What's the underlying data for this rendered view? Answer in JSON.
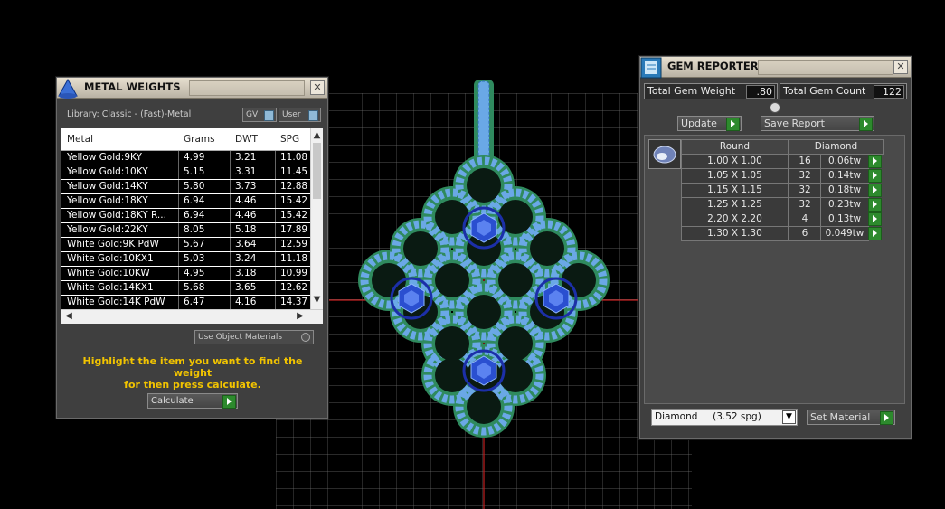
{
  "metal_weights": {
    "title": "METAL WEIGHTS",
    "library_label": "Library: Classic - (Fast)-Metal",
    "gv_toggle": "GV",
    "user_toggle": "User",
    "columns": [
      "Metal",
      "Grams",
      "DWT",
      "SPG"
    ],
    "rows": [
      [
        "Yellow Gold:9KY",
        "4.99",
        "3.21",
        "11.08"
      ],
      [
        "Yellow Gold:10KY",
        "5.15",
        "3.31",
        "11.45"
      ],
      [
        "Yellow Gold:14KY",
        "5.80",
        "3.73",
        "12.88"
      ],
      [
        "Yellow Gold:18KY",
        "6.94",
        "4.46",
        "15.42"
      ],
      [
        "Yellow Gold:18KY R...",
        "6.94",
        "4.46",
        "15.42"
      ],
      [
        "Yellow Gold:22KY",
        "8.05",
        "5.18",
        "17.89"
      ],
      [
        "White Gold:9K PdW",
        "5.67",
        "3.64",
        "12.59"
      ],
      [
        "White Gold:10KX1",
        "5.03",
        "3.24",
        "11.18"
      ],
      [
        "White Gold:10KW",
        "4.95",
        "3.18",
        "10.99"
      ],
      [
        "White Gold:14KX1",
        "5.68",
        "3.65",
        "12.62"
      ],
      [
        "White Gold:14K PdW",
        "6.47",
        "4.16",
        "14.37"
      ]
    ],
    "use_object_materials": "Use Object Materials",
    "instruction_line1": "Highlight the item you want to find the weight",
    "instruction_line2": "for then press calculate.",
    "calculate_label": "Calculate"
  },
  "gem_reporter": {
    "title": "GEM REPORTER",
    "total_gem_weight_label": "Total Gem Weight",
    "total_gem_weight_value": ".80",
    "total_gem_count_label": "Total Gem Count",
    "total_gem_count_value": "122",
    "update_label": "Update",
    "save_report_label": "Save Report",
    "table_headers": [
      "Round",
      "Diamond"
    ],
    "rows": [
      [
        "1.00 X 1.00",
        "16",
        "0.06tw"
      ],
      [
        "1.05 X 1.05",
        "32",
        "0.14tw"
      ],
      [
        "1.15 X 1.15",
        "32",
        "0.18tw"
      ],
      [
        "1.25 X 1.25",
        "32",
        "0.23tw"
      ],
      [
        "2.20 X 2.20",
        "4",
        "0.13tw"
      ],
      [
        "1.30 X 1.30",
        "6",
        "0.049tw"
      ]
    ],
    "material_select": "Diamond     (3.52 spg)",
    "set_material_label": "Set Material"
  },
  "colors": {
    "grid": "#7a7a7a",
    "metal_green": "#2f8a5e",
    "metal_blue": "#6aa8e6",
    "gem_blue": "#2a4fd0",
    "accent_yellow": "#f2c400",
    "play_green": "#2d8a2d"
  }
}
